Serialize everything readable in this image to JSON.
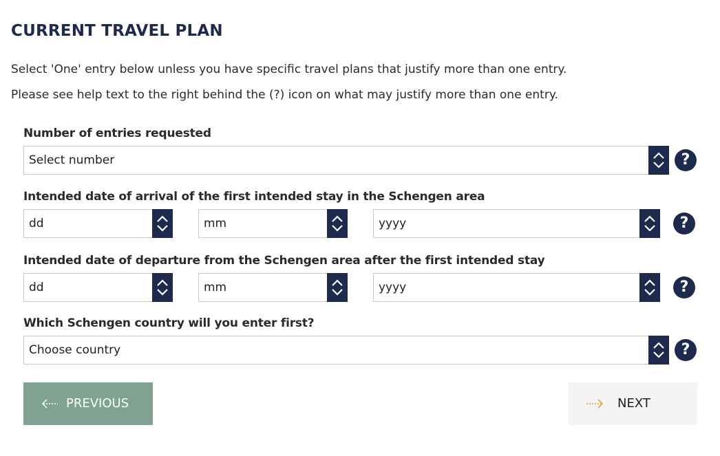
{
  "section": {
    "title": "CURRENT TRAVEL PLAN",
    "intro_1": "Select 'One' entry below unless you have specific travel plans that justify more than one entry.",
    "intro_2": "Please see help text to the right behind the (?) icon on what may justify more than one entry."
  },
  "entries": {
    "label": "Number of entries requested",
    "value": "Select number"
  },
  "arrival": {
    "label": "Intended date of arrival of the first intended stay in the Schengen area",
    "day": "dd",
    "month": "mm",
    "year": "yyyy"
  },
  "departure": {
    "label": "Intended date of departure from the Schengen area after the first intended stay",
    "day": "dd",
    "month": "mm",
    "year": "yyyy"
  },
  "country": {
    "label": "Which Schengen country will you enter first?",
    "value": "Choose country"
  },
  "help": {
    "glyph": "?"
  },
  "nav": {
    "previous": "PREVIOUS",
    "next": "NEXT"
  },
  "colors": {
    "navy": "#1d2a4d",
    "previous_button": "#7fa293",
    "next_button": "#f4f4f4",
    "next_arrow": "#d99a2b"
  },
  "icons": {
    "spinner": "chevron-up-down-icon",
    "help": "question-mark-icon",
    "previous": "arrow-left-icon",
    "next": "arrow-right-icon"
  }
}
